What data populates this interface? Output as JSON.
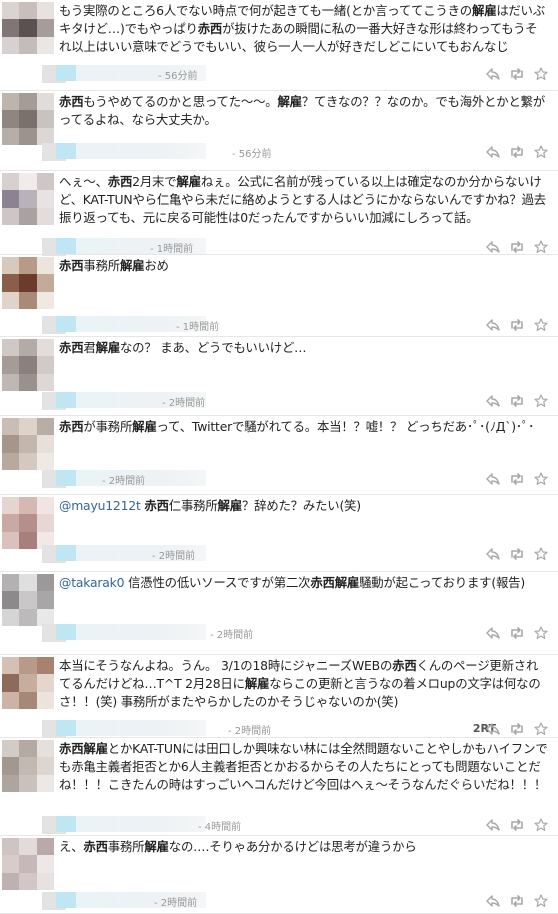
{
  "tweets": [
    {
      "segments": [
        {
          "t": "もう実際のところ6人でない時点で何が起きても一緒(とか言っててこうきの"
        },
        {
          "t": "解雇",
          "b": true
        },
        {
          "t": "はだいぶキタけど…)でもやっぱり"
        },
        {
          "t": "赤西",
          "b": true
        },
        {
          "t": "が抜けたあの瞬間に私の一番大好きな形は終わってもうそれ以上はいい意味でどうでもいい、彼ら一人一人が好きだしどこにいてもおんなじ"
        }
      ],
      "time": "- 56分前"
    },
    {
      "segments": [
        {
          "t": "赤西",
          "b": true
        },
        {
          "t": "もうやめてるのかと思ってた〜〜。"
        },
        {
          "t": "解雇",
          "b": true
        },
        {
          "t": "？てきなの？？なのか。でも海外とかと繋がってるよね、なら大丈夫か。"
        }
      ],
      "time": "- 56分前"
    },
    {
      "segments": [
        {
          "t": "へぇ〜、"
        },
        {
          "t": "赤西",
          "b": true
        },
        {
          "t": "2月末で"
        },
        {
          "t": "解雇",
          "b": true
        },
        {
          "t": "ねぇ。公式に名前が残っている以上は確定なのか分からないけど、KAT-TUNやら仁亀やら未だに絡めようとする人はどうにかならないんですかね？過去振り返っても、元に戻る可能性は0だったんですからいい加減にしろって話。"
        }
      ],
      "time": "- 1時間前"
    },
    {
      "segments": [
        {
          "t": "赤西",
          "b": true
        },
        {
          "t": "事務所"
        },
        {
          "t": "解雇",
          "b": true
        },
        {
          "t": "おめ"
        }
      ],
      "time": "- 1時間前"
    },
    {
      "segments": [
        {
          "t": "赤西",
          "b": true
        },
        {
          "t": "君"
        },
        {
          "t": "解雇",
          "b": true
        },
        {
          "t": "なの？ まあ、どうでもいいけど…"
        }
      ],
      "time": "- 2時間前"
    },
    {
      "segments": [
        {
          "t": "赤西",
          "b": true
        },
        {
          "t": "が事務所"
        },
        {
          "t": "解雇",
          "b": true
        },
        {
          "t": "って、Twitterで騒がれてる。本当！？嘘！？ どっちだあ･ﾟ･(ﾉД`)･ﾟ･"
        }
      ],
      "time": "- 2時間前"
    },
    {
      "segments": [
        {
          "t": "@mayu1212t",
          "m": true
        },
        {
          "t": " "
        },
        {
          "t": "赤西",
          "b": true
        },
        {
          "t": "仁事務所"
        },
        {
          "t": "解雇",
          "b": true
        },
        {
          "t": "？辞めた？みたい(笑)"
        }
      ],
      "time": "- 2時間前"
    },
    {
      "segments": [
        {
          "t": "@takarak0",
          "m": true
        },
        {
          "t": " 信憑性の低いソースですが第二次"
        },
        {
          "t": "赤西解雇",
          "b": true
        },
        {
          "t": "騒動が起こっております(報告)"
        }
      ],
      "time": "- 2時間前"
    },
    {
      "segments": [
        {
          "t": "本当にそうなんよね。うん。 3/1の18時にジャニーズWEBの"
        },
        {
          "t": "赤西",
          "b": true
        },
        {
          "t": "くんのページ更新されてるんだけどね…T^T 2月28日に"
        },
        {
          "t": "解雇",
          "b": true
        },
        {
          "t": "ならこの更新と言うなの着メロupの文字は何なのさ！！(笑) 事務所がまたやらかしたのかそうじゃないのか(笑)"
        }
      ],
      "time": "- 2時間前",
      "rt": "2RT"
    },
    {
      "segments": [
        {
          "t": "赤西解雇",
          "b": true
        },
        {
          "t": "とかKAT-TUNには田口しか興味ない林には全然問題ないことやしかもハイフンでも赤亀主義者拒否とか6人主義者拒否とかおるからその人たちにとっても問題ないことだね！！！こきたんの時はすっごいヘコんだけど今回はへぇ〜そうなんだぐらいだね！！！"
        }
      ],
      "time": "- 4時間前"
    },
    {
      "segments": [
        {
          "t": "え、"
        },
        {
          "t": "赤西",
          "b": true
        },
        {
          "t": "事務所"
        },
        {
          "t": "解雇",
          "b": true
        },
        {
          "t": "なの‥‥そりゃあ分かるけどは思考が違うから"
        }
      ],
      "time": "- 2時間前"
    }
  ],
  "icons": {
    "reply": "reply-icon",
    "retweet": "retweet-icon",
    "favorite": "star-icon"
  },
  "colors": {
    "mention": "#336699",
    "timestamp": "#999999",
    "icon": "#a8a8a8"
  }
}
